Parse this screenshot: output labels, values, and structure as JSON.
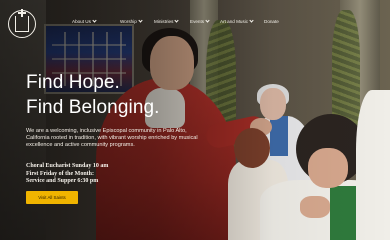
{
  "nav": {
    "items": [
      {
        "label": "About Us",
        "has_dropdown": true
      },
      {
        "label": "Worship",
        "has_dropdown": true
      },
      {
        "label": "Ministries",
        "has_dropdown": true
      },
      {
        "label": "Events",
        "has_dropdown": true
      },
      {
        "label": "Art and Music",
        "has_dropdown": true
      },
      {
        "label": "Donate",
        "has_dropdown": false
      }
    ]
  },
  "hero": {
    "headline_line1": "Find Hope.",
    "headline_line2": "Find Belonging.",
    "intro": "We are a welcoming, inclusive Episcopal community in Palo Alto, California rooted in tradition, with vibrant worship enriched by musical excellence and active community programs.",
    "schedule": {
      "line1": "Choral Eucharist Sunday 10 am",
      "line2": "First Friday of the Month:",
      "line3": "Service and Supper 6:30 pm"
    },
    "cta_label": "Visit All Saints"
  },
  "colors": {
    "cta_background": "#f0b400",
    "text": "#ffffff"
  }
}
